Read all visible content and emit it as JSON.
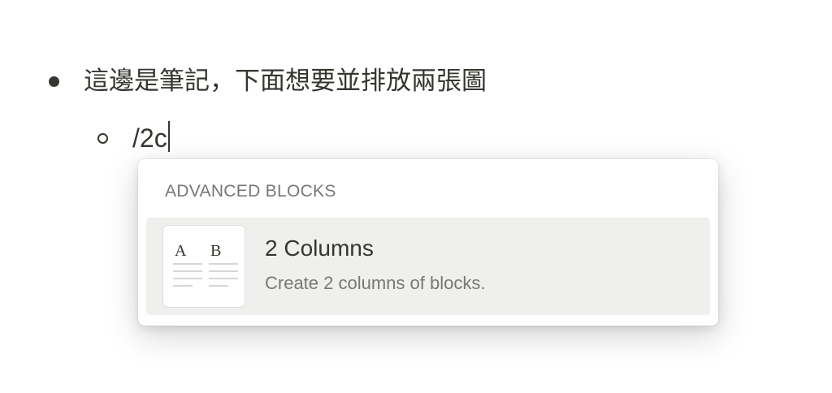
{
  "editor": {
    "bullet_text": "這邊是筆記，下面想要並排放兩張圖",
    "slash_command": "/2c"
  },
  "command_menu": {
    "section_label": "ADVANCED BLOCKS",
    "items": [
      {
        "title": "2 Columns",
        "description": "Create 2 columns of blocks.",
        "icon": "two-columns-icon",
        "icon_letters": [
          "A",
          "B"
        ],
        "selected": true
      }
    ]
  }
}
